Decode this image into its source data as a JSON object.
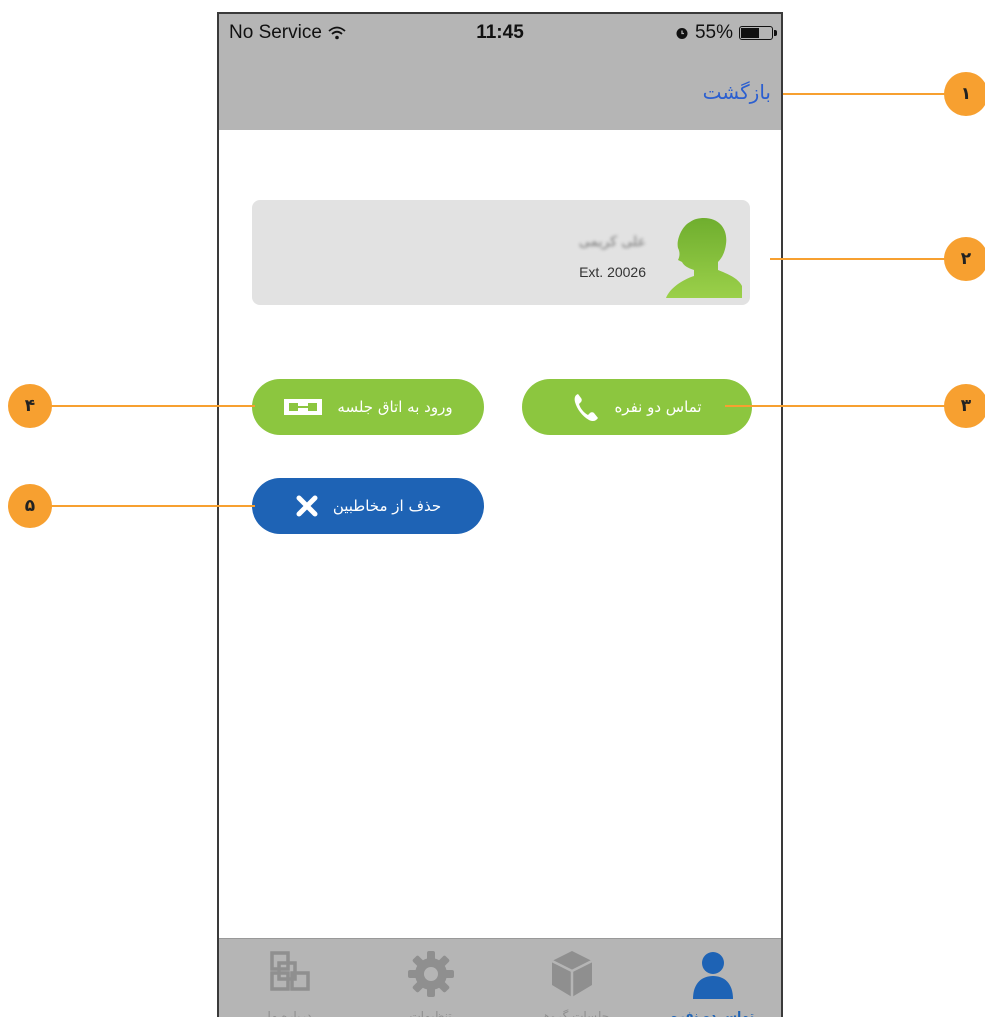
{
  "status_bar": {
    "carrier": "No Service",
    "time": "11:45",
    "battery": "55%",
    "battery_level": 0.55
  },
  "nav": {
    "back_label": "بازگشت"
  },
  "contact": {
    "name": "علی کریمی",
    "extension": "Ext. 20026",
    "avatar_color": "#8cc63f"
  },
  "actions": {
    "call_label": "تماس دو نفره",
    "room_label": "ورود به اتاق جلسه",
    "delete_label": "حذف از مخاطبین"
  },
  "tabs": [
    {
      "label": "تماس دو نفره",
      "icon": "person-icon",
      "active": true
    },
    {
      "label": "جلسات گروهی",
      "icon": "cube-icon",
      "active": false
    },
    {
      "label": "تنظیمات",
      "icon": "gear-icon",
      "active": false
    },
    {
      "label": "درباره ما",
      "icon": "blocks-icon",
      "active": false
    }
  ],
  "callouts": [
    "۱",
    "۲",
    "۳",
    "۴",
    "۵"
  ],
  "colors": {
    "accent_green": "#8cc63f",
    "accent_blue": "#1e63b5",
    "callout_orange": "#f7a030",
    "link_blue": "#2b5fd0"
  }
}
